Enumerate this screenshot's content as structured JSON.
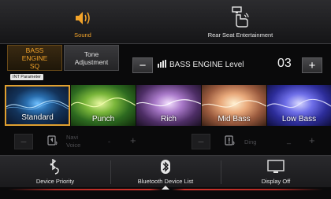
{
  "topbar": {
    "sound_label": "Sound",
    "rear_seat_label": "Rear Seat Entertainment"
  },
  "tabs": {
    "bass_engine_sq": "BASS ENGINE SQ",
    "tone_adjustment": "Tone Adjustment"
  },
  "int_parameter": "INT Parameter",
  "level": {
    "label": "BASS ENGINE Level",
    "value": "03",
    "minus": "−",
    "plus": "+"
  },
  "presets": [
    {
      "label": "Standard",
      "selected": true
    },
    {
      "label": "Punch",
      "selected": false
    },
    {
      "label": "Rich",
      "selected": false
    },
    {
      "label": "Mid Bass",
      "selected": false
    },
    {
      "label": "Low Bass",
      "selected": false
    }
  ],
  "voice": {
    "navi_line1": "Navi",
    "navi_line2": "Voice",
    "ding": "Ding",
    "minus": "−",
    "plus": "+",
    "navi_value": "-",
    "ding_value": "_"
  },
  "bottombar": {
    "device_priority": "Device Priority",
    "bluetooth_list": "Bluetooth Device List",
    "display_off": "Display Off"
  },
  "colors": {
    "accent": "#f2a32a",
    "accent_line": "#c0302a"
  }
}
